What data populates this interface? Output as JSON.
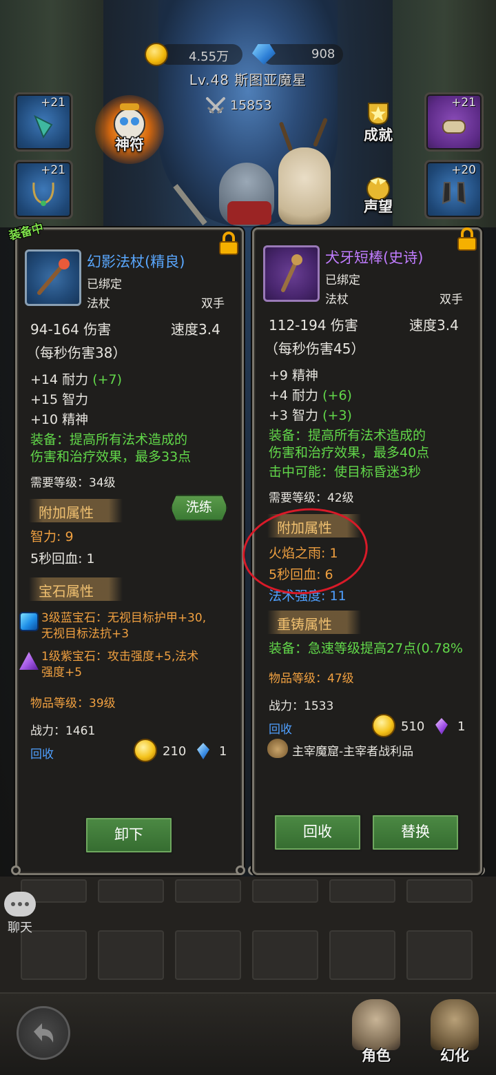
{
  "currency": {
    "gold": "4.55万",
    "gems": "908"
  },
  "player": {
    "level_name": "Lv.48 斯图亚魔星",
    "power": "15853"
  },
  "slots": {
    "left_top_plus": "+21",
    "left_mid_plus": "+21",
    "right_top_plus": "+21",
    "right_mid_plus": "+20"
  },
  "features": {
    "shenfu": "神符",
    "achievements": "成就",
    "reputation": "声望"
  },
  "equipped_tag": "装备中",
  "left_item": {
    "name": "幻影法杖(精良)",
    "bound": "已绑定",
    "type": "法杖",
    "hand": "双手",
    "damage": "94-164 伤害",
    "speed": "速度3.4",
    "dps": "（每秒伤害38）",
    "stat1": "+14 耐力",
    "stat1_bonus": "(+7)",
    "stat2": "+15 智力",
    "stat3": "+10 精神",
    "equip_line1": "装备：提高所有法术造成的",
    "equip_line2": "伤害和治疗效果，最多33点",
    "req_level": "需要等级：34级",
    "extra_title": "附加属性",
    "wash_label": "洗练",
    "extra1": "智力: 9",
    "extra2": "5秒回血: 1",
    "gem_title": "宝石属性",
    "gem1_line1": "3级蓝宝石：无视目标护甲+30,",
    "gem1_line2": "无视目标法抗+3",
    "gem2_line1": "1级紫宝石：攻击强度+5,法术",
    "gem2_line2": "强度+5",
    "item_level": "物品等级：39级",
    "power": "战力：1461",
    "recycle": "回收",
    "sell_gold": "210",
    "sell_gem": "1",
    "unequip": "卸下"
  },
  "right_item": {
    "name": "犬牙短棒(史诗)",
    "bound": "已绑定",
    "type": "法杖",
    "hand": "双手",
    "damage": "112-194 伤害",
    "speed": "速度3.4",
    "dps": "（每秒伤害45）",
    "stat1": "+9 精神",
    "stat2": "+4 耐力",
    "stat2_bonus": "(+6)",
    "stat3": "+3 智力",
    "stat3_bonus": "(+3)",
    "equip_line1": "装备：提高所有法术造成的",
    "equip_line2": "伤害和治疗效果，最多40点",
    "equip_line3": "击中可能：使目标昏迷3秒",
    "req_level": "需要等级：42级",
    "extra_title": "附加属性",
    "extra1": "火焰之雨: 1",
    "extra2": "5秒回血: 6",
    "extra3": "法术强度: 11",
    "reforge_title": "重铸属性",
    "reforge1": "装备：急速等级提高27点(0.78%",
    "item_level": "物品等级：47级",
    "power": "战力：1533",
    "recycle": "回收",
    "sell_gold": "510",
    "sell_gem": "1",
    "source": "主宰魔窟-主宰者战利品",
    "btn_recycle": "回收",
    "btn_replace": "替换"
  },
  "chat_label": "聊天",
  "nav": {
    "character": "角色",
    "illusion": "幻化"
  }
}
